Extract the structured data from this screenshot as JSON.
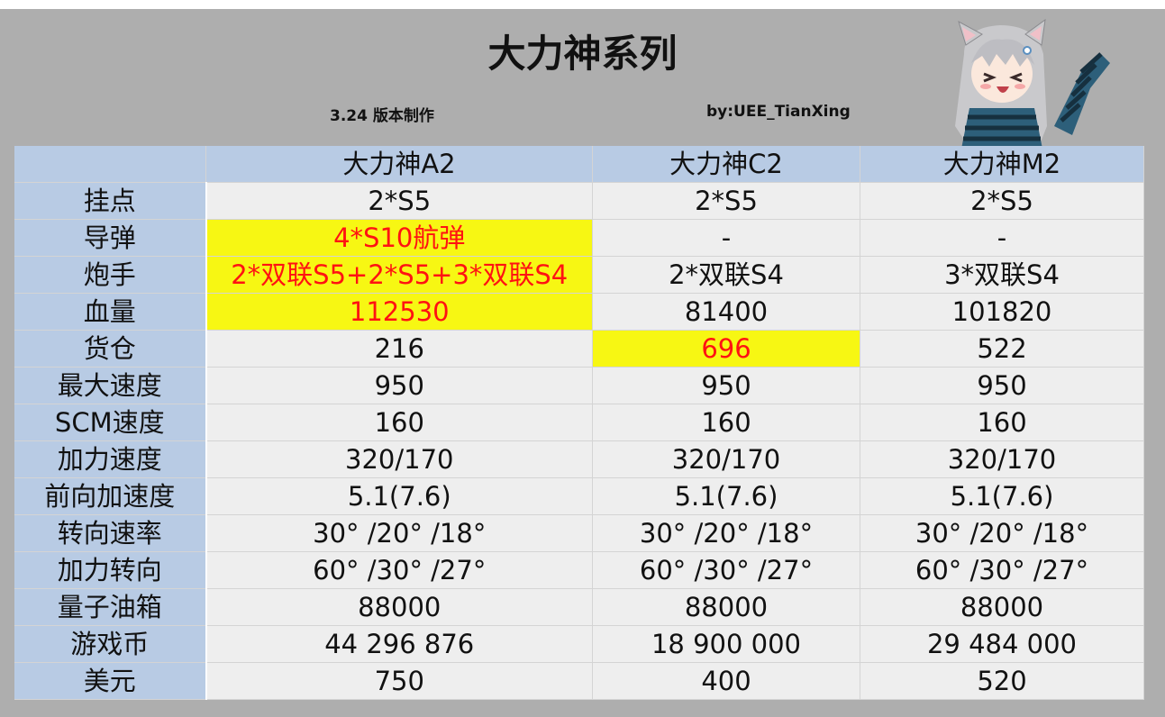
{
  "header": {
    "title": "大力神系列",
    "version_note": "3.24 版本制作",
    "author": "by:UEE_TianXing"
  },
  "colors": {
    "label_bg": "#b8cbe4",
    "cell_bg": "#eeeeee",
    "highlight_bg": "#f7f713",
    "highlight_text": "#ff1212"
  },
  "table": {
    "columns": [
      "大力神A2",
      "大力神C2",
      "大力神M2"
    ],
    "rows": [
      {
        "label": "挂点",
        "values": [
          "2*S5",
          "2*S5",
          "2*S5"
        ]
      },
      {
        "label": "导弹",
        "values": [
          "4*S10航弹",
          "-",
          "-"
        ]
      },
      {
        "label": "炮手",
        "values": [
          "2*双联S5+2*S5+3*双联S4",
          "2*双联S4",
          "3*双联S4"
        ]
      },
      {
        "label": "血量",
        "values": [
          "112530",
          "81400",
          "101820"
        ]
      },
      {
        "label": "货仓",
        "values": [
          "216",
          "696",
          "522"
        ]
      },
      {
        "label": "最大速度",
        "values": [
          "950",
          "950",
          "950"
        ]
      },
      {
        "label": "SCM速度",
        "values": [
          "160",
          "160",
          "160"
        ]
      },
      {
        "label": "加力速度",
        "values": [
          "320/170",
          "320/170",
          "320/170"
        ]
      },
      {
        "label": "前向加速度",
        "values": [
          "5.1(7.6)",
          "5.1(7.6)",
          "5.1(7.6)"
        ]
      },
      {
        "label": "转向速率",
        "values": [
          "30° /20° /18°",
          "30° /20° /18°",
          "30° /20° /18°"
        ]
      },
      {
        "label": "加力转向",
        "values": [
          "60° /30° /27°",
          "60° /30° /27°",
          "60° /30° /27°"
        ]
      },
      {
        "label": "量子油箱",
        "values": [
          "88000",
          "88000",
          "88000"
        ]
      },
      {
        "label": "游戏币",
        "values": [
          "44 296 876",
          "18 900 000",
          "29 484 000"
        ]
      },
      {
        "label": "美元",
        "values": [
          "750",
          "400",
          "520"
        ]
      }
    ],
    "highlighted_cells": [
      {
        "row": 1,
        "col": 0
      },
      {
        "row": 2,
        "col": 0
      },
      {
        "row": 3,
        "col": 0
      },
      {
        "row": 4,
        "col": 1
      }
    ]
  }
}
